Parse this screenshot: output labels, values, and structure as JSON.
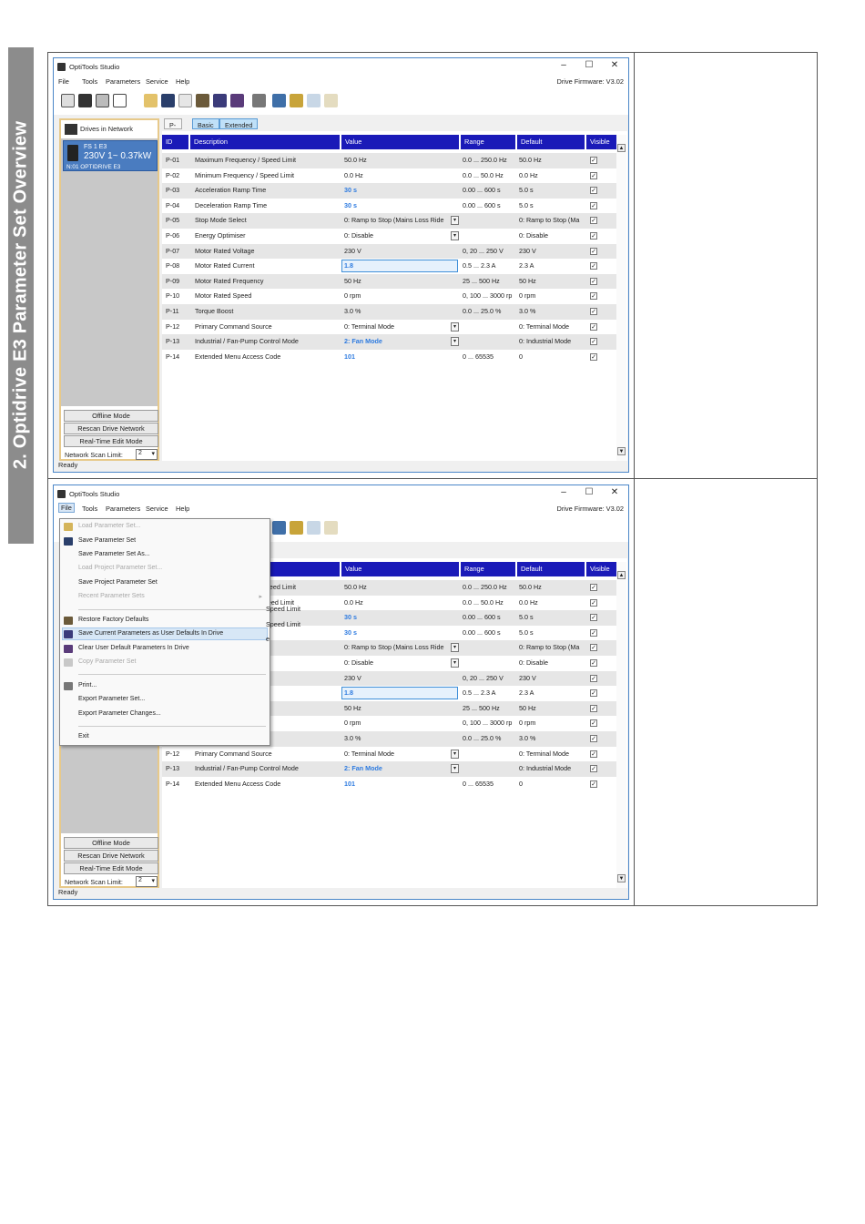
{
  "side_heading": "2. Optidrive E3 Parameter Set Overview",
  "app": {
    "title": "OptiTools Studio",
    "window_controls": [
      "–",
      "☐",
      "✕"
    ],
    "menu": [
      "File",
      "Tools",
      "Parameters",
      "Service",
      "Help"
    ],
    "firmware": "Drive Firmware: V3.02",
    "status": "Ready"
  },
  "sidebar": {
    "heading": "Drives in Network",
    "drive": {
      "line1": "FS 1 E3",
      "line2": "230V 1~ 0.37kW",
      "line3": "N:01 OPTIDRIVE E3"
    },
    "buttons": [
      "Offline Mode",
      "Rescan Drive Network",
      "Real-Time Edit Mode"
    ],
    "scan_label": "Network Scan Limit:",
    "scan_value": "2"
  },
  "tabs": [
    "P-00",
    "Basic",
    "Extended"
  ],
  "columns": [
    "ID",
    "Description",
    "Value",
    "Range",
    "Default",
    "Visible"
  ],
  "rows": [
    {
      "id": "P-01",
      "desc": "Maximum Frequency / Speed Limit",
      "value": "50.0 Hz",
      "range": "0.0 ... 250.0 Hz",
      "default": "50.0 Hz"
    },
    {
      "id": "P-02",
      "desc": "Minimum Frequency / Speed Limit",
      "value": "0.0 Hz",
      "range": "0.0 ... 50.0 Hz",
      "default": "0.0 Hz"
    },
    {
      "id": "P-03",
      "desc": "Acceleration Ramp Time",
      "value": "30 s",
      "range": "0.00 ... 600 s",
      "default": "5.0 s"
    },
    {
      "id": "P-04",
      "desc": "Deceleration Ramp Time",
      "value": "30 s",
      "range": "0.00 ... 600 s",
      "default": "5.0 s"
    },
    {
      "id": "P-05",
      "desc": "Stop Mode Select",
      "value": "0: Ramp to Stop (Mains Loss Ride",
      "range": "",
      "default": "0: Ramp to Stop (Ma"
    },
    {
      "id": "P-06",
      "desc": "Energy Optimiser",
      "value": "0: Disable",
      "range": "",
      "default": "0: Disable"
    },
    {
      "id": "P-07",
      "desc": "Motor Rated Voltage",
      "value": "230 V",
      "range": "0, 20 ... 250 V",
      "default": "230 V"
    },
    {
      "id": "P-08",
      "desc": "Motor Rated Current",
      "value": "1.8",
      "range": "0.5 ... 2.3 A",
      "default": "2.3 A"
    },
    {
      "id": "P-09",
      "desc": "Motor Rated Frequency",
      "value": "50 Hz",
      "range": "25 ... 500 Hz",
      "default": "50 Hz"
    },
    {
      "id": "P-10",
      "desc": "Motor Rated Speed",
      "value": "0 rpm",
      "range": "0, 100 ... 3000 rp",
      "default": "0 rpm"
    },
    {
      "id": "P-11",
      "desc": "Torque Boost",
      "value": "3.0 %",
      "range": "0.0 ... 25.0 %",
      "default": "3.0 %"
    },
    {
      "id": "P-12",
      "desc": "Primary Command Source",
      "value": "0: Terminal Mode",
      "range": "",
      "default": "0: Terminal Mode"
    },
    {
      "id": "P-13",
      "desc": "Industrial / Fan-Pump Control Mode",
      "value": "2: Fan Mode",
      "range": "",
      "default": "0: Industrial Mode"
    },
    {
      "id": "P-14",
      "desc": "Extended Menu Access Code",
      "value": "101",
      "range": "0 ... 65535",
      "default": "0"
    }
  ],
  "second_value_p08": "1.8",
  "file_menu": [
    "Load Parameter Set...",
    "Save Parameter Set",
    "Save Parameter Set As...",
    "Load Project Parameter Set...",
    "Save Project Parameter Set",
    "Recent Parameter Sets",
    "Restore Factory Defaults",
    "Save Current Parameters as User Defaults In Drive",
    "Clear User Default Parameters In Drive",
    "Copy Parameter Set",
    "Print...",
    "Export Parameter Set...",
    "Export Parameter Changes...",
    "Exit"
  ],
  "partial_rows": [
    "Speed Limit",
    "Speed Limit",
    "e"
  ]
}
